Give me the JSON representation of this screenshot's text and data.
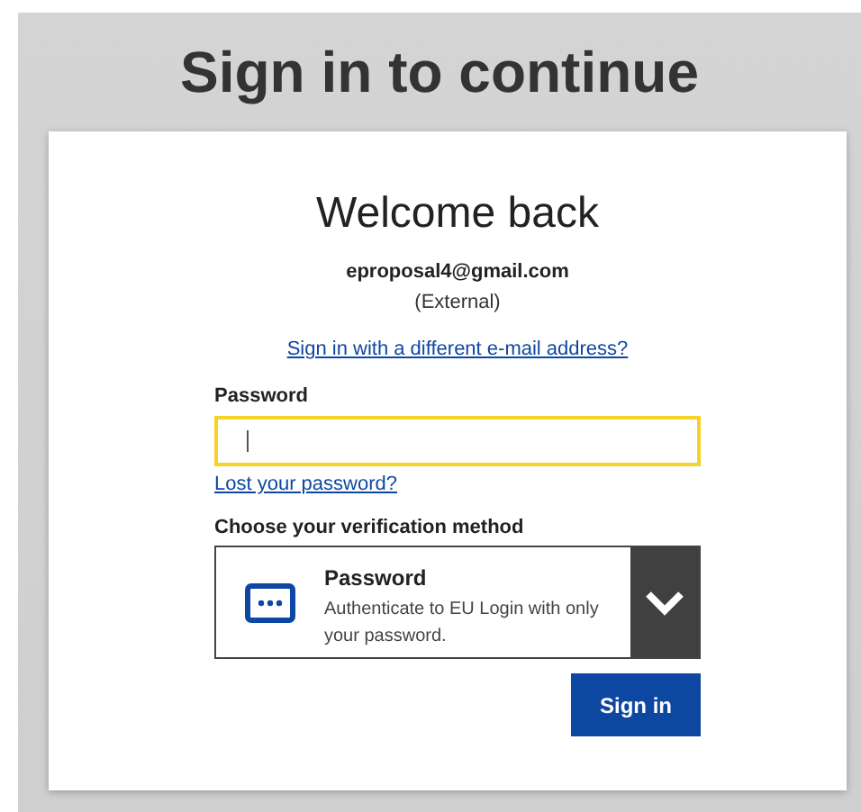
{
  "page_title": "Sign in to continue",
  "card": {
    "heading": "Welcome back",
    "email": "eproposal4@gmail.com",
    "account_type": "(External)",
    "switch_link": "Sign in with a different e-mail address?",
    "password_field": {
      "label": "Password",
      "focused": true
    },
    "lost_password_link": "Lost your password?",
    "verification": {
      "label": "Choose your verification method",
      "method_title": "Password",
      "method_description": "Authenticate to EU Login with only your password.",
      "expanded": false
    },
    "submit_button": "Sign in"
  }
}
